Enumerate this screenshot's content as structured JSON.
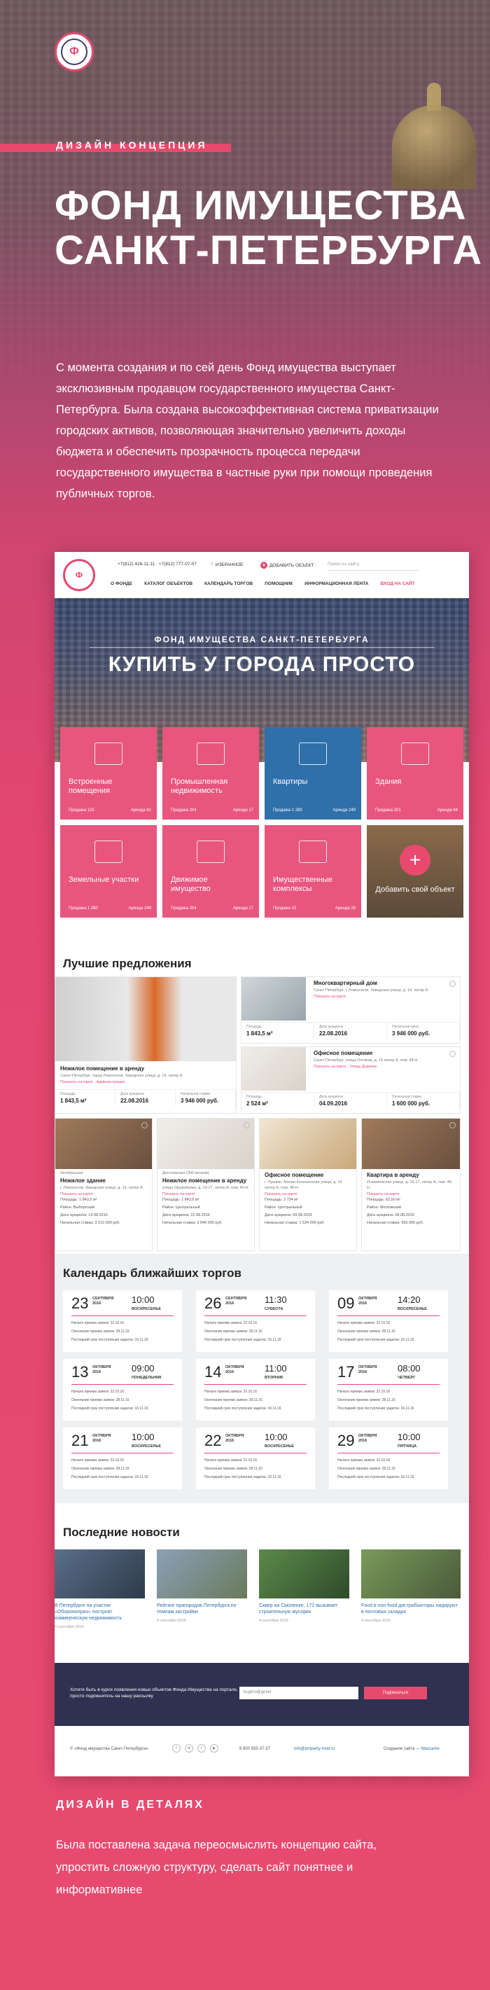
{
  "concept_label": "ДИЗАЙН КОНЦЕПЦИЯ",
  "title_line1": "ФОНД ИМУЩЕСТВА",
  "title_line2": "САНКТ-ПЕТЕРБУРГА",
  "intro": "С момента создания и по сей день Фонд имущества выступает эксклюзивным продавцом государственного имущества Санкт-Петербурга. Была создана высокоэффективная система приватизации городских активов, позволяющая значительно увеличить доходы бюджета и обеспечить прозрачность процесса передачи государственного имущества в частные руки при помощи проведения публичных торгов.",
  "site": {
    "header": {
      "phones": "+7(812) 426-11-11 · +7(812) 777-07-07",
      "favorites": "ИЗБРАННОЕ",
      "add_object": "ДОБАВИТЬ ОБЪЕКТ",
      "search_placeholder": "Поиск по сайту",
      "nav": [
        "О ФОНДЕ",
        "КАТАЛОГ ОБЪЕКТОВ",
        "КАЛЕНДАРЬ ТОРГОВ",
        "ПОМОЩНИК",
        "ИНФОРМАЦИОННАЯ ЛЕНТА"
      ],
      "login": "ВХОД НА САЙТ"
    },
    "hero": {
      "subtitle": "ФОНД ИМУЩЕСТВА САНКТ-ПЕТЕРБУРГА",
      "headline": "КУПИТЬ У ГОРОДА ПРОСТО"
    },
    "categories": [
      {
        "title": "Встроенные помещения",
        "sale": "Продажа 125",
        "rent": "Аренда 61"
      },
      {
        "title": "Промышленная недвижимость",
        "sale": "Продажа 204",
        "rent": "Аренда 17"
      },
      {
        "title": "Квартиры",
        "sale": "Продажа 1 280",
        "rent": "Аренда 249"
      },
      {
        "title": "Здания",
        "sale": "Продажа 201",
        "rent": "Аренда 84"
      },
      {
        "title": "Земельные участки",
        "sale": "Продажа 1 280",
        "rent": "Аренда 249"
      },
      {
        "title": "Движимое имущество",
        "sale": "Продажа 204",
        "rent": "Аренда 17"
      },
      {
        "title": "Имущественные комплексы",
        "sale": "Продажа 15",
        "rent": "Аренда 26"
      },
      {
        "title": "Добавить свой объект",
        "sale": "",
        "rent": ""
      }
    ],
    "offers": {
      "heading": "Лучшие предложения",
      "big": {
        "title": "Нежилое помещение в аренду",
        "address": "Санкт-Петербург, город Ломоносов, Заводская улица, д. 14, литер А",
        "map": "Показать на карте",
        "label": "Администрация",
        "area_label": "Площадь",
        "area": "1 843,5 м²",
        "date_label": "Дата аукциона",
        "date": "22.08.2016",
        "price_label": "Начальная ставка",
        "price": "3 946 000 руб."
      },
      "right1": {
        "title": "Многоквартирный дом",
        "address": "Санкт-Петербург, г. Ломоносов, Заводская улица, д. 14, литер А",
        "map": "Показать на карте",
        "area_label": "Площадь",
        "area": "1 843,5 м²",
        "date_label": "Дата аукциона",
        "date": "22.08.2016",
        "price_label": "Начальная цена",
        "price": "3 946 000 руб."
      },
      "right2": {
        "title": "Офисное помещение",
        "address": "Санкт-Петербург, улица Оптиков, д. 16 литер А, пом. 48-Н",
        "map": "Показать на карте",
        "tag": "Улица Дудинки",
        "area_label": "Площадь",
        "area": "2 524 м²",
        "date_label": "Дата аукциона",
        "date": "04.09.2016",
        "price_label": "Начальная ставка",
        "price": "1 600 000 руб."
      },
      "small": [
        {
          "label": "Октябрьская",
          "title": "Нежилое здание",
          "address": "г. Ломоносов, Заводская улица, д. 14, литер А",
          "map": "Показать на карте",
          "l1": "Площадь: 1 843,5 м²",
          "l2": "Район: Выборгский",
          "l3": "Дата аукциона: 13.08.2016",
          "l4": "Начальная ставка: 3 210 000 руб."
        },
        {
          "label": "Достоевская (300 метров)",
          "title": "Нежилое помещение в аренду",
          "address": "улица Оружейника, д. 15-17, литер А, пом. 40-Н",
          "map": "Показать на карте",
          "l1": "Площадь: 1 843,5 м²",
          "l2": "Район: Центральный",
          "l3": "Дата аукциона: 22.08.2016",
          "l4": "Начальная ставка: 3 946 000 руб."
        },
        {
          "label": "",
          "title": "Офисное помещение",
          "address": "г. Пушкин, Малая Конюшенная улица, д. 15 литер А, пом. 48-Н",
          "map": "Показать на карте",
          "l1": "Площадь: 2 734 м²",
          "l2": "Район: Центральный",
          "l3": "Дата аукциона: 09.08.2016",
          "l4": "Начальная ставка: 1 534 000 руб."
        },
        {
          "label": "",
          "title": "Квартира в аренду",
          "address": "Исаакиевская улица, д. 18-17, литер А, пом. 48-Н",
          "map": "Показать на карте",
          "l1": "Площадь: 62,50 м²",
          "l2": "Район: Московский",
          "l3": "Дата аукциона: 08.08.2016",
          "l4": "Начальная ставка: 650 000 руб."
        }
      ]
    },
    "calendar": {
      "heading": "Календарь ближайших торгов",
      "r1": "Начало приема заявок: 22.10.16",
      "r2": "Окончание приема заявок: 28.11.16",
      "r3": "Последний срок поступления задатка: 16.11.16",
      "slots": [
        {
          "day": "23",
          "month": "СЕНТЯБРЯ",
          "year": "2016",
          "time": "10:00",
          "weekday": "ВОСКРЕСЕНЬЕ"
        },
        {
          "day": "26",
          "month": "СЕНТЯБРЯ",
          "year": "2016",
          "time": "11:30",
          "weekday": "СУББОТА"
        },
        {
          "day": "09",
          "month": "ОКТЯБРЯ",
          "year": "2016",
          "time": "14:20",
          "weekday": "ВОСКРЕСЕНЬЕ"
        },
        {
          "day": "13",
          "month": "ОКТЯБРЯ",
          "year": "2016",
          "time": "09:00",
          "weekday": "ПОНЕДЕЛЬНИК"
        },
        {
          "day": "14",
          "month": "ОКТЯБРЯ",
          "year": "2016",
          "time": "11:00",
          "weekday": "ВТОРНИК"
        },
        {
          "day": "17",
          "month": "ОКТЯБРЯ",
          "year": "2016",
          "time": "08:00",
          "weekday": "ЧЕТВЕРГ"
        },
        {
          "day": "21",
          "month": "ОКТЯБРЯ",
          "year": "2016",
          "time": "10:00",
          "weekday": "ВОСКРЕСЕНЬЕ"
        },
        {
          "day": "22",
          "month": "ОКТЯБРЯ",
          "year": "2016",
          "time": "10:00",
          "weekday": "ВОСКРЕСЕНЬЕ"
        },
        {
          "day": "29",
          "month": "ОКТЯБРЯ",
          "year": "2016",
          "time": "10:00",
          "weekday": "ПЯТНИЦА"
        }
      ]
    },
    "news": {
      "heading": "Последние новости",
      "items": [
        {
          "title": "В Петербурге на участке «Обороноприз» построят коммерческую недвижимость",
          "date": "4 сентября 2016"
        },
        {
          "title": "Рейтинг пригородов Петербурга по темпам застройки",
          "date": "4 сентября 2016"
        },
        {
          "title": "Сквер на Смоленке, 172 вызывает строительную мусорки",
          "date": "4 сентября 2016"
        },
        {
          "title": "Food в non-food дистрибьюторы лидируют в почтовых складах",
          "date": "4 сентября 2016"
        }
      ]
    },
    "subscribe": {
      "text": "Хотите быть в курсе появления новых объектов Фонда Имущества на портале, просто подпишитесь на нашу рассылку",
      "placeholder": "bugbro@gmail",
      "button": "Подписаться"
    },
    "footer": {
      "copyright": "© «Фонд имущества Санкт-Петербурга»",
      "phone": "8 800 555-37-37",
      "email": "info@property-fund.ru",
      "made": "Создание сайта —",
      "studio": "Mascame"
    }
  },
  "details_heading": "ДИЗАЙН В ДЕТАЛЯХ",
  "details_text": "Была поставлена задача переосмыслить концепцию сайта, упростить сложную структуру, сделать сайт понятнее и информативнее",
  "colors": {
    "accent": "#e84a6f",
    "navy": "#2e3250",
    "link": "#2f6faa"
  }
}
